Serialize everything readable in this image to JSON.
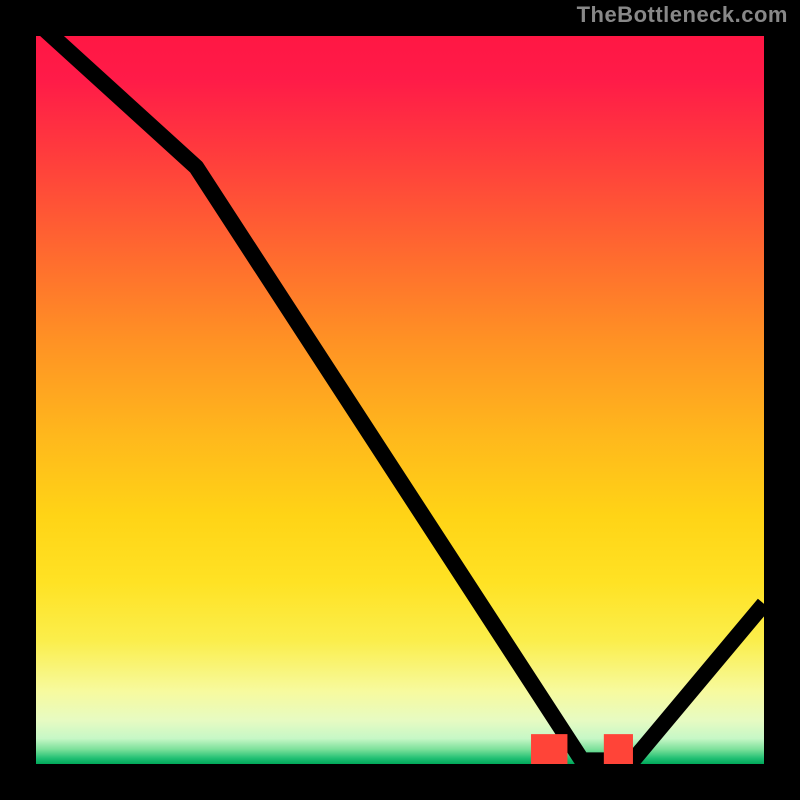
{
  "watermark": "TheBottleneck.com",
  "chart_data": {
    "type": "line",
    "title": "",
    "xlabel": "",
    "ylabel": "",
    "xlim": [
      0,
      100
    ],
    "ylim": [
      0,
      100
    ],
    "x": [
      0,
      22,
      75,
      82,
      100
    ],
    "values": [
      102,
      82,
      0.5,
      0.5,
      22
    ],
    "highlight_segment": {
      "x0": 68,
      "x1": 82,
      "y": 0.5
    },
    "background_gradient_stops": [
      {
        "pos": 0,
        "color": "#ff1744"
      },
      {
        "pos": 30,
        "color": "#ff6a2f"
      },
      {
        "pos": 66,
        "color": "#ffd416"
      },
      {
        "pos": 90,
        "color": "#f7fa9e"
      },
      {
        "pos": 100,
        "color": "#00a85a"
      }
    ]
  }
}
